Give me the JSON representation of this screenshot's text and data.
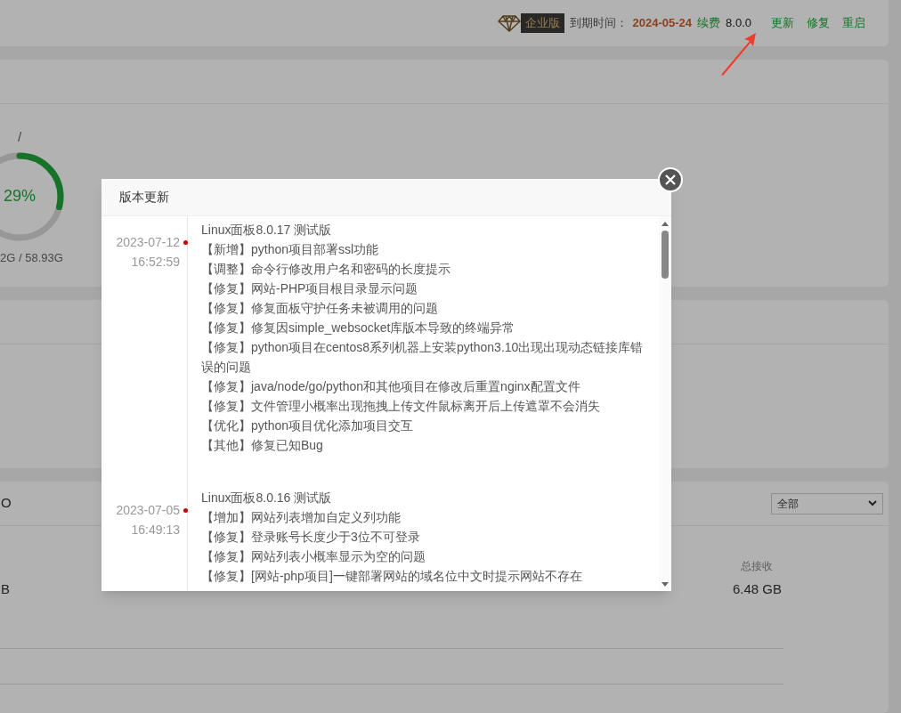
{
  "header": {
    "edition_badge": "企业版",
    "expiry_label": "到期时间：",
    "expiry_date": "2024-05-24",
    "renew_link": "续费",
    "version": "8.0.0",
    "actions": [
      "更新",
      "修复",
      "重启"
    ]
  },
  "disk": {
    "mount": "/",
    "percent": "29%",
    "level": 0.29,
    "usage": "2G / 58.93G"
  },
  "traffic": {
    "title_fragment": "O",
    "filter": "全部",
    "value_fragment": "B",
    "total_label": "总接收",
    "total_value": "6.48 GB"
  },
  "modal": {
    "title": "版本更新",
    "entries": [
      {
        "date": "2023-07-12",
        "time": "16:52:59",
        "title": "Linux面板8.0.17 测试版",
        "items": [
          "【新增】python项目部署ssl功能",
          "【调整】命令行修改用户名和密码的长度提示",
          "【修复】网站-PHP项目根目录显示问题",
          "【修复】修复面板守护任务未被调用的问题",
          "【修复】修复因simple_websocket库版本导致的终端异常",
          "【修复】python项目在centos8系列机器上安装python3.10出现出现动态链接库错误的问题",
          "【修复】java/node/go/python和其他项目在修改后重置nginx配置文件",
          "【修复】文件管理小概率出现拖拽上传文件鼠标离开后上传遮罩不会消失",
          "【优化】python项目优化添加项目交互",
          "【其他】修复已知Bug"
        ]
      },
      {
        "date": "2023-07-05",
        "time": "16:49:13",
        "title": "Linux面板8.0.16 测试版",
        "items": [
          "【增加】网站列表增加自定义列功能",
          "【修复】登录账号长度少于3位不可登录",
          "【修复】网站列表小概率显示为空的问题",
          "【修复】[网站-php项目]一键部署网站的域名位中文时提示网站不存在"
        ]
      }
    ]
  }
}
